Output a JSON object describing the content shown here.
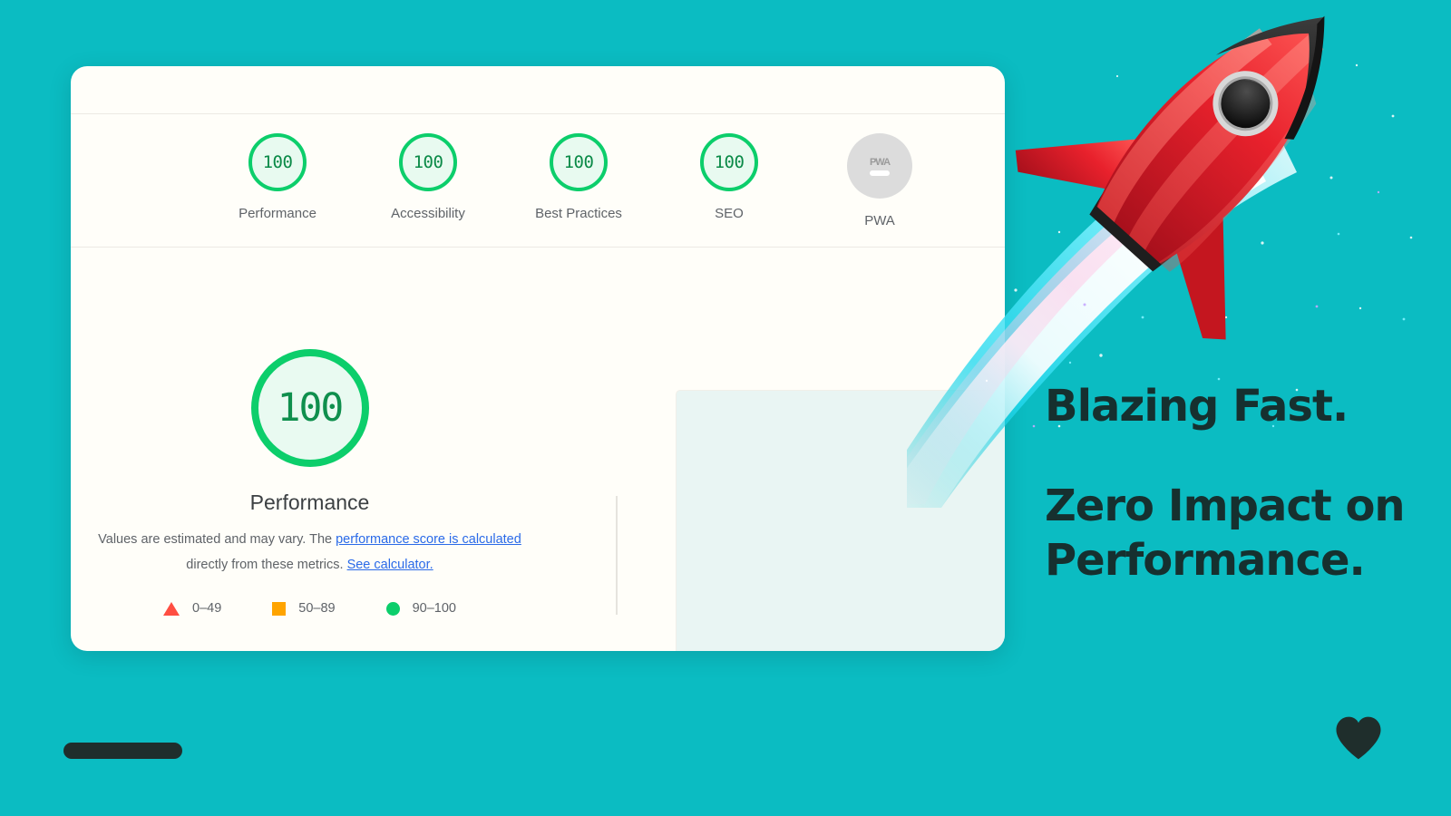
{
  "theme": {
    "background": "#0bbcc2",
    "card_background": "#fffef9",
    "good_green": "#0cce6b",
    "good_green_fill": "#e8faf0",
    "average_orange": "#ffa400",
    "poor_red": "#ff4e42",
    "null_gray": "#dcdcdc",
    "link_blue": "#2a6ae8",
    "headline_color": "#16302f",
    "panel_mint": "#e9f5f3"
  },
  "report": {
    "scores": [
      {
        "label": "Performance",
        "value": "100",
        "state": "good"
      },
      {
        "label": "Accessibility",
        "value": "100",
        "state": "good"
      },
      {
        "label": "Best Practices",
        "value": "100",
        "state": "good"
      },
      {
        "label": "SEO",
        "value": "100",
        "state": "good"
      },
      {
        "label": "PWA",
        "value": "PWA",
        "state": "null"
      }
    ],
    "detail": {
      "gauge_value": "100",
      "gauge_label": "Performance",
      "disclaimer": {
        "lead": "Values are estimated and may vary. The ",
        "link1": "performance score is calculated",
        "mid": " directly from these metrics. ",
        "link2": "See calculator."
      },
      "legend": [
        {
          "shape": "triangle",
          "range": "0–49",
          "color": "#ff4e42"
        },
        {
          "shape": "square",
          "range": "50–89",
          "color": "#ffa400"
        },
        {
          "shape": "circle",
          "range": "90–100",
          "color": "#0cce6b"
        }
      ]
    }
  },
  "marketing": {
    "headline_line1": "Blazing Fast.",
    "headline_line2": "Zero Impact on Performance."
  }
}
